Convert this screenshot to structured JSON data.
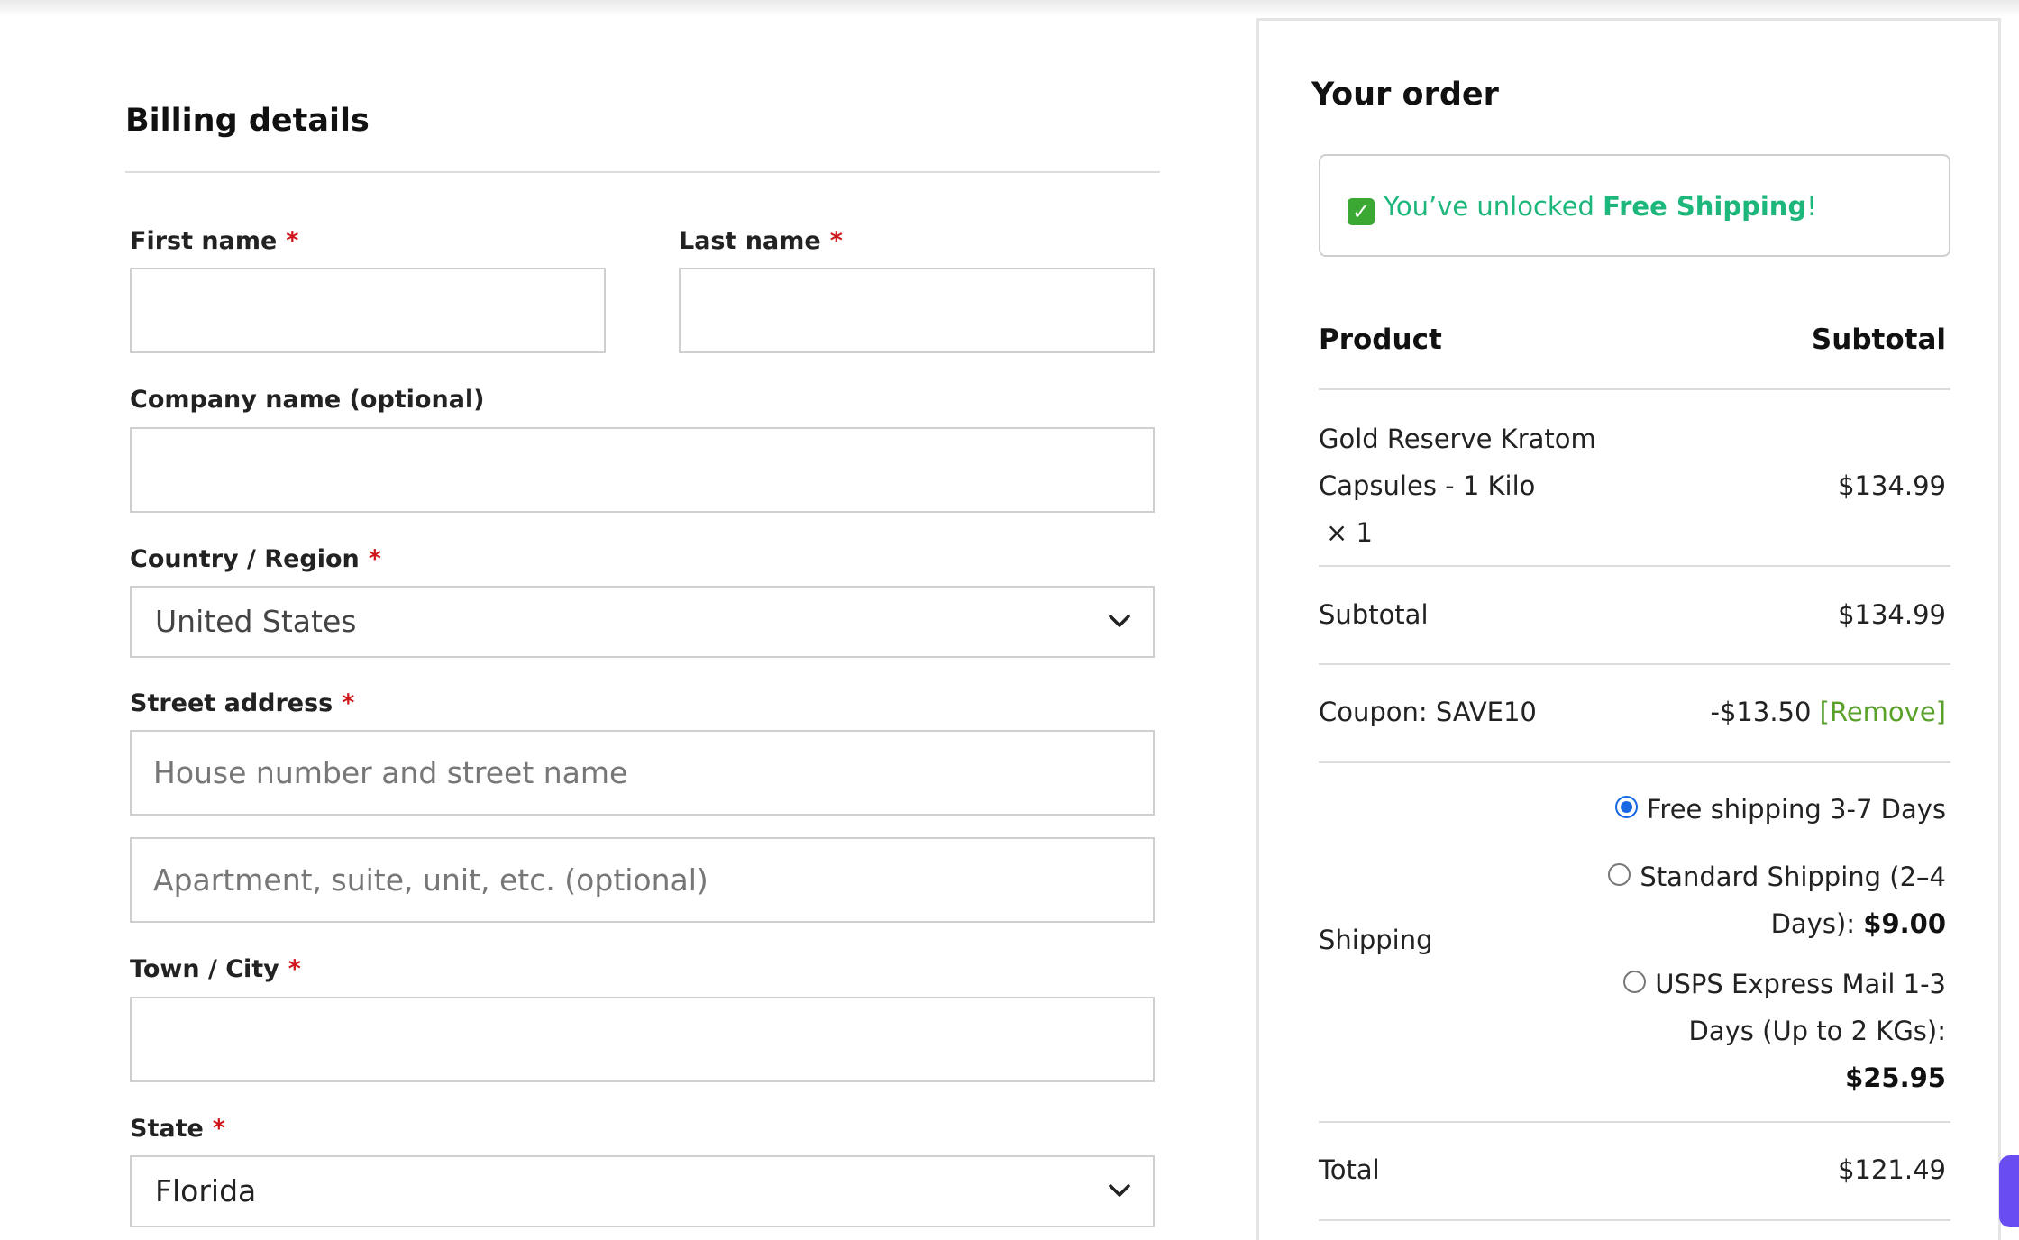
{
  "billing": {
    "title": "Billing details",
    "required_mark": "*",
    "first_name": {
      "label": "First name",
      "value": ""
    },
    "last_name": {
      "label": "Last name",
      "value": ""
    },
    "company": {
      "label": "Company name (optional)",
      "value": ""
    },
    "country": {
      "label": "Country / Region",
      "value": "United States"
    },
    "street": {
      "label": "Street address",
      "placeholder_1": "House number and street name",
      "placeholder_2": "Apartment, suite, unit, etc. (optional)"
    },
    "city": {
      "label": "Town / City",
      "value": ""
    },
    "state": {
      "label": "State",
      "value": "Florida"
    }
  },
  "order": {
    "title": "Your order",
    "notice": {
      "prefix": "You’ve unlocked ",
      "highlight": "Free Shipping",
      "suffix": "!"
    },
    "columns": {
      "product": "Product",
      "subtotal": "Subtotal"
    },
    "item": {
      "name_line1": "Gold Reserve Kratom",
      "name_line2": "Capsules - 1 Kilo",
      "qty": "× 1",
      "price": "$134.99"
    },
    "subtotal": {
      "label": "Subtotal",
      "value": "$134.99"
    },
    "coupon": {
      "label": "Coupon: SAVE10",
      "value": "-$13.50",
      "remove": "[Remove]"
    },
    "shipping": {
      "label": "Shipping",
      "options": [
        {
          "line1": "Free shipping 3-7 Days",
          "selected": true
        },
        {
          "line1": "Standard Shipping (2–4",
          "line2": "Days): ",
          "price": "$9.00",
          "selected": false
        },
        {
          "line1": "USPS Express Mail 1-3",
          "line2": "Days (Up to 2 KGs):",
          "price": "$25.95",
          "selected": false
        }
      ]
    },
    "total": {
      "label": "Total",
      "value": "$121.49"
    }
  },
  "colors": {
    "accent_green": "#1db77b",
    "remove_green": "#5aa12a",
    "required_red": "#d0161b",
    "radio_blue": "#1668e3"
  }
}
